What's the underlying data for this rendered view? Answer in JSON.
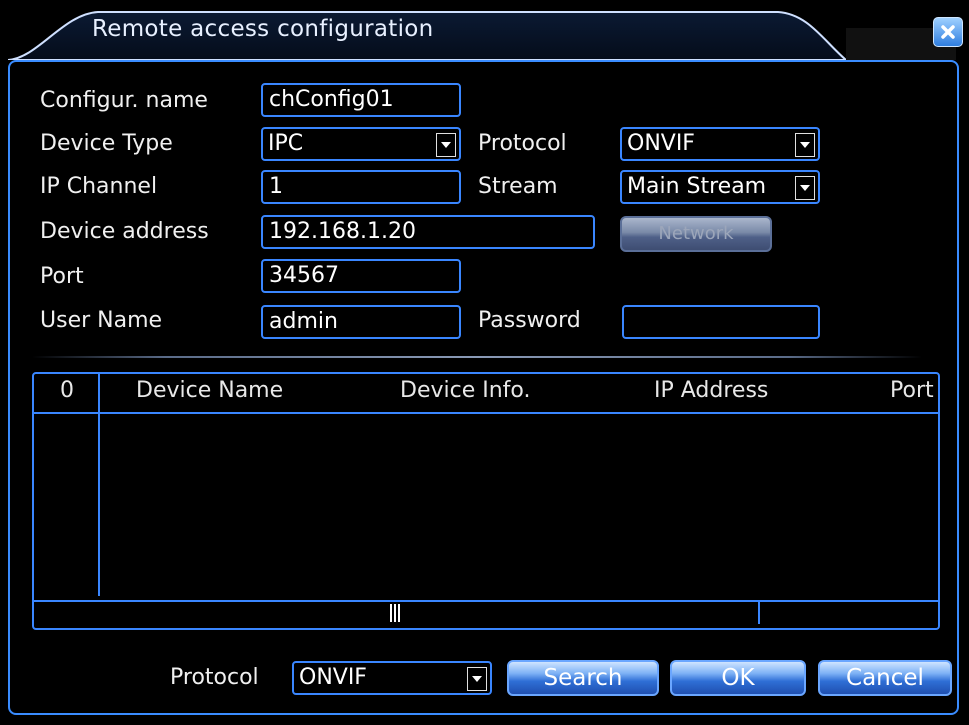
{
  "window": {
    "title": "Remote access configuration"
  },
  "form": {
    "config_name_label": "Configur. name",
    "config_name_value": "chConfig01",
    "device_type_label": "Device Type",
    "device_type_value": "IPC",
    "protocol_label": "Protocol",
    "protocol_value": "ONVIF",
    "ip_channel_label": "IP Channel",
    "ip_channel_value": "1",
    "stream_label": "Stream",
    "stream_value": "Main Stream",
    "device_address_label": "Device address",
    "device_address_value": "192.168.1.20",
    "network_button": "Network",
    "port_label": "Port",
    "port_value": "34567",
    "username_label": "User Name",
    "username_value": "admin",
    "password_label": "Password",
    "password_value": ""
  },
  "table": {
    "columns": [
      "0",
      "Device Name",
      "Device Info.",
      "IP Address",
      "Port"
    ],
    "rows": []
  },
  "footer": {
    "protocol_label": "Protocol",
    "protocol_value": "ONVIF",
    "search_button": "Search",
    "ok_button": "OK",
    "cancel_button": "Cancel"
  },
  "colors": {
    "accent": "#3a86ff",
    "background": "#000000",
    "button": "#2f6fd6"
  }
}
